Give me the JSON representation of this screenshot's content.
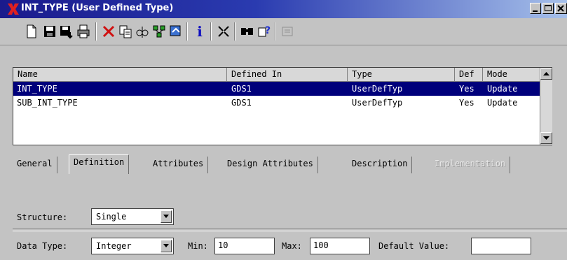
{
  "window": {
    "title": "INT_TYPE (User Defined Type)"
  },
  "toolbar": {
    "icons": [
      "new-icon",
      "save-icon",
      "save-as-icon",
      "print-icon",
      "delete-icon",
      "copy-icon",
      "compare-icon",
      "relations-icon",
      "refresh-icon",
      "info-icon",
      "query-icon",
      "find-icon",
      "help-icon",
      "report-icon"
    ],
    "info_glyph": "i"
  },
  "table": {
    "columns": [
      "Name",
      "Defined In",
      "Type",
      "Def",
      "Mode"
    ],
    "rows": [
      {
        "name": "INT_TYPE",
        "defined_in": "GDS1",
        "type": "UserDefTyp",
        "def": "Yes",
        "mode": "Update",
        "selected": true
      },
      {
        "name": "SUB_INT_TYPE",
        "defined_in": "GDS1",
        "type": "UserDefTyp",
        "def": "Yes",
        "mode": "Update",
        "selected": false
      }
    ]
  },
  "tabs": [
    {
      "label": "General",
      "state": "normal"
    },
    {
      "label": "Definition",
      "state": "active"
    },
    {
      "label": "Attributes",
      "state": "normal"
    },
    {
      "label": "Design Attributes",
      "state": "normal"
    },
    {
      "label": "Description",
      "state": "normal"
    },
    {
      "label": "Implementation",
      "state": "disabled"
    }
  ],
  "form": {
    "structure_label": "Structure:",
    "structure_value": "Single",
    "data_type_label": "Data Type:",
    "data_type_value": "Integer",
    "min_label": "Min:",
    "min_value": "10",
    "max_label": "Max:",
    "max_value": "100",
    "default_value_label": "Default Value:",
    "default_value": ""
  },
  "colors": {
    "selection": "#00007b",
    "title_start": "#1a1a8c",
    "title_end": "#a6c0ea",
    "face": "#c3c3c3"
  }
}
